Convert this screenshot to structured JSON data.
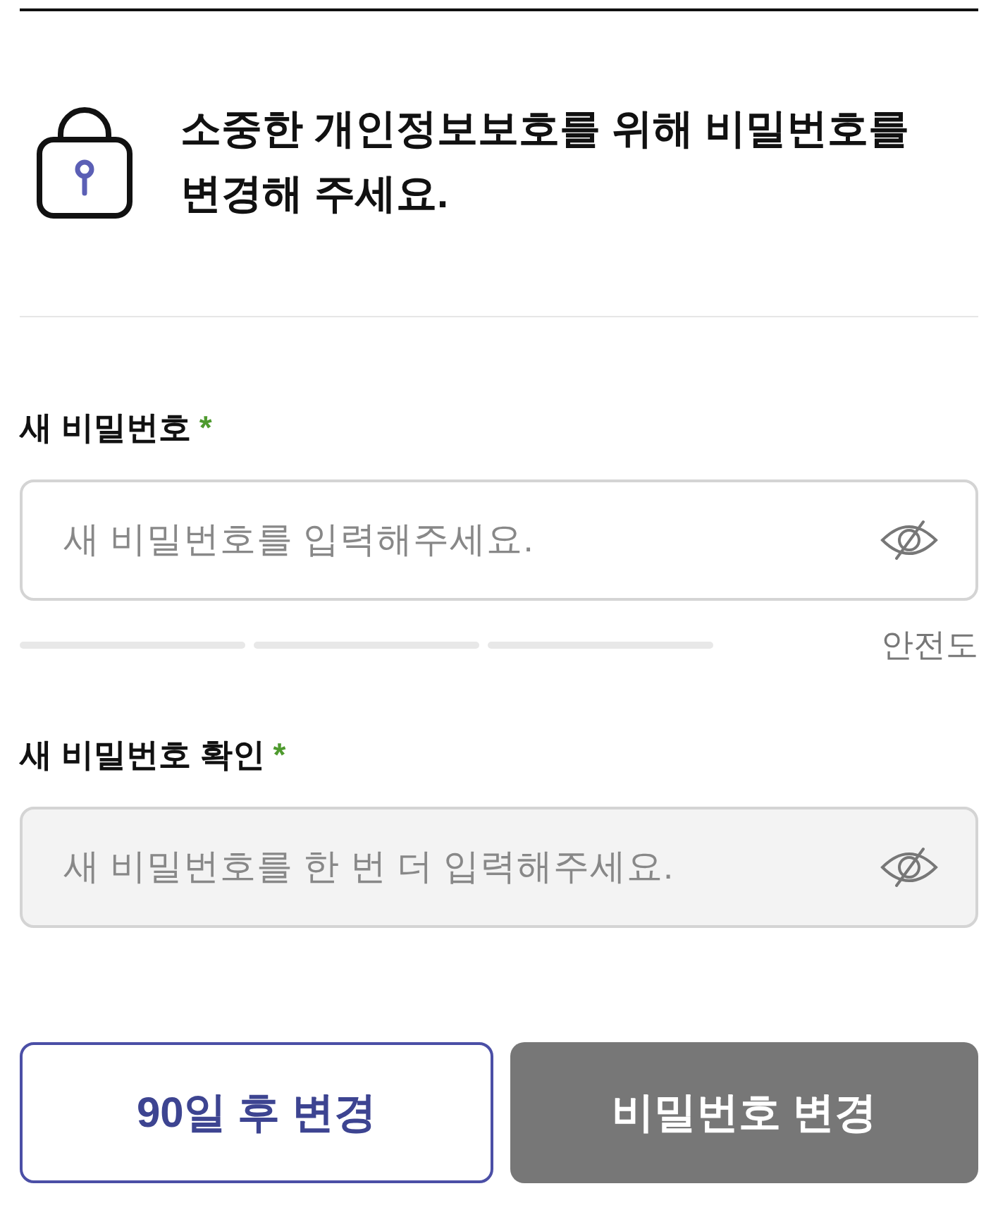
{
  "header": {
    "title": "소중한 개인정보보호를 위해 비밀번호를 변경해 주세요."
  },
  "fields": [
    {
      "label": "새 비밀번호",
      "required_mark": "*",
      "placeholder": "새 비밀번호를 입력해주세요.",
      "disabled": false,
      "password_visible": false,
      "strength": {
        "label": "안전도",
        "segments": [
          {
            "filled": false
          },
          {
            "filled": false
          },
          {
            "filled": false
          }
        ]
      }
    },
    {
      "label": "새 비밀번호 확인",
      "required_mark": "*",
      "placeholder": "새 비밀번호를 한 번 더 입력해주세요.",
      "disabled": true,
      "password_visible": false
    }
  ],
  "buttons": [
    {
      "label": "90일 후 변경",
      "kind": "outline",
      "disabled": false
    },
    {
      "label": "비밀번호 변경",
      "kind": "primary",
      "disabled": true
    }
  ]
}
